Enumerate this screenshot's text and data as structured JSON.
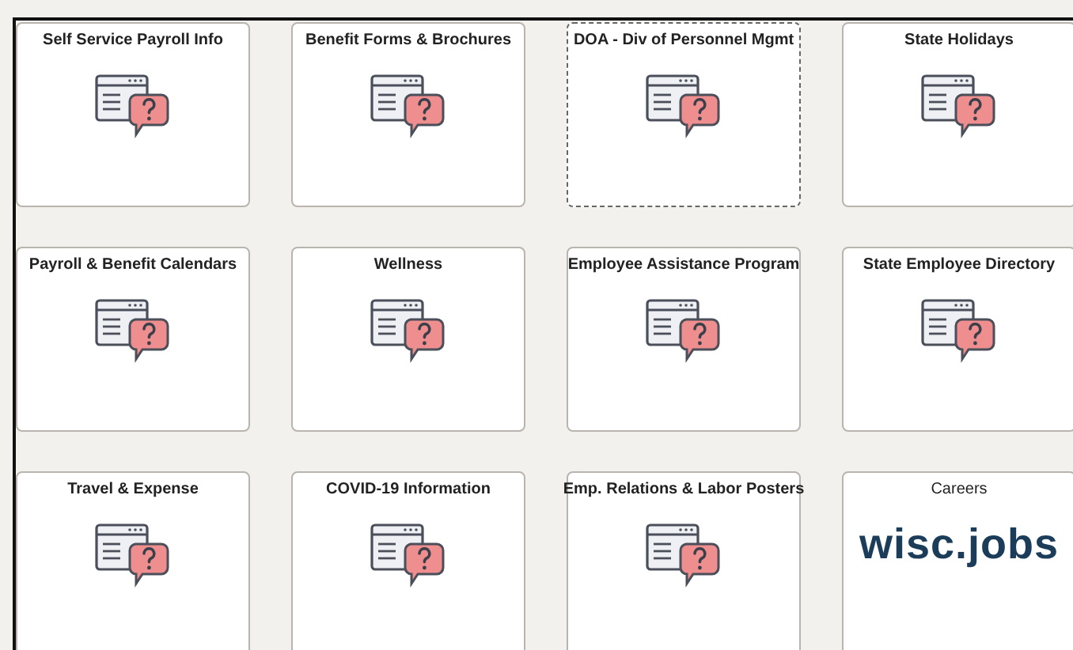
{
  "tiles": [
    {
      "title": "Self Service Payroll Info",
      "kind": "help",
      "focused": false
    },
    {
      "title": "Benefit Forms & Brochures",
      "kind": "help",
      "focused": false
    },
    {
      "title": "DOA - Div of Personnel Mgmt",
      "kind": "help",
      "focused": true
    },
    {
      "title": "State Holidays",
      "kind": "help",
      "focused": false
    },
    {
      "title": "Payroll & Benefit Calendars",
      "kind": "help",
      "focused": false
    },
    {
      "title": "Wellness",
      "kind": "help",
      "focused": false
    },
    {
      "title": "Employee Assistance Program",
      "kind": "help",
      "focused": false
    },
    {
      "title": "State Employee Directory",
      "kind": "help",
      "focused": false
    },
    {
      "title": "Travel & Expense",
      "kind": "help",
      "focused": false
    },
    {
      "title": "COVID-19 Information",
      "kind": "help",
      "focused": false
    },
    {
      "title": "Emp. Relations & Labor Posters",
      "kind": "help",
      "focused": false
    },
    {
      "title": "Careers",
      "kind": "logo",
      "logo": "wisc.jobs",
      "focused": false
    }
  ]
}
